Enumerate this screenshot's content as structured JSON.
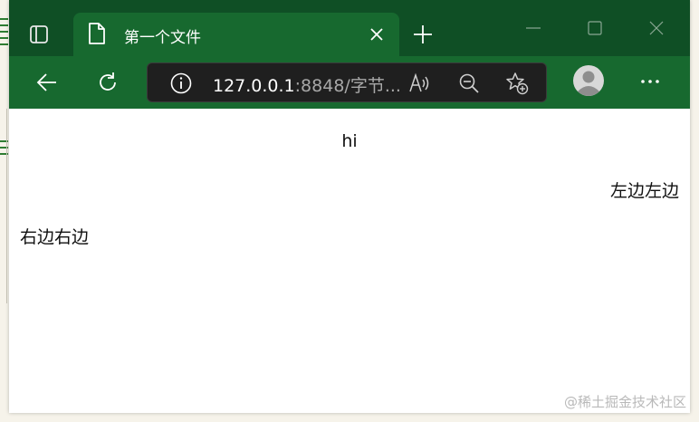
{
  "colors": {
    "titlebar": "#0f4f25",
    "tab_active": "#17692f",
    "toolbar": "#17692f",
    "addressbar": "#1f1f1f",
    "url_host": "#ffffff",
    "url_rest": "#a8a8a8"
  },
  "titlebar": {
    "tab_actions_icon": "tab-actions-icon",
    "active_tab": {
      "icon": "page-icon",
      "title": "第一个文件",
      "close_icon": "close-icon"
    },
    "new_tab_icon": "plus-icon",
    "window_controls": [
      "minimize-icon",
      "maximize-icon",
      "close-icon"
    ]
  },
  "toolbar": {
    "back_icon": "arrow-left-icon",
    "refresh_icon": "refresh-icon",
    "address": {
      "info_icon": "info-icon",
      "url_host": "127.0.0.1",
      "url_rest": ":8848/字节...",
      "read_aloud_icon": "read-aloud-icon",
      "zoom_icon": "zoom-out-icon",
      "favorites_icon": "star-plus-icon"
    },
    "profile_icon": "profile-avatar",
    "more_icon": "ellipsis-icon"
  },
  "page": {
    "center_text": "hi",
    "right_text": "左边左边",
    "left_text": "右边右边"
  },
  "watermark": "@稀土掘金技术社区"
}
